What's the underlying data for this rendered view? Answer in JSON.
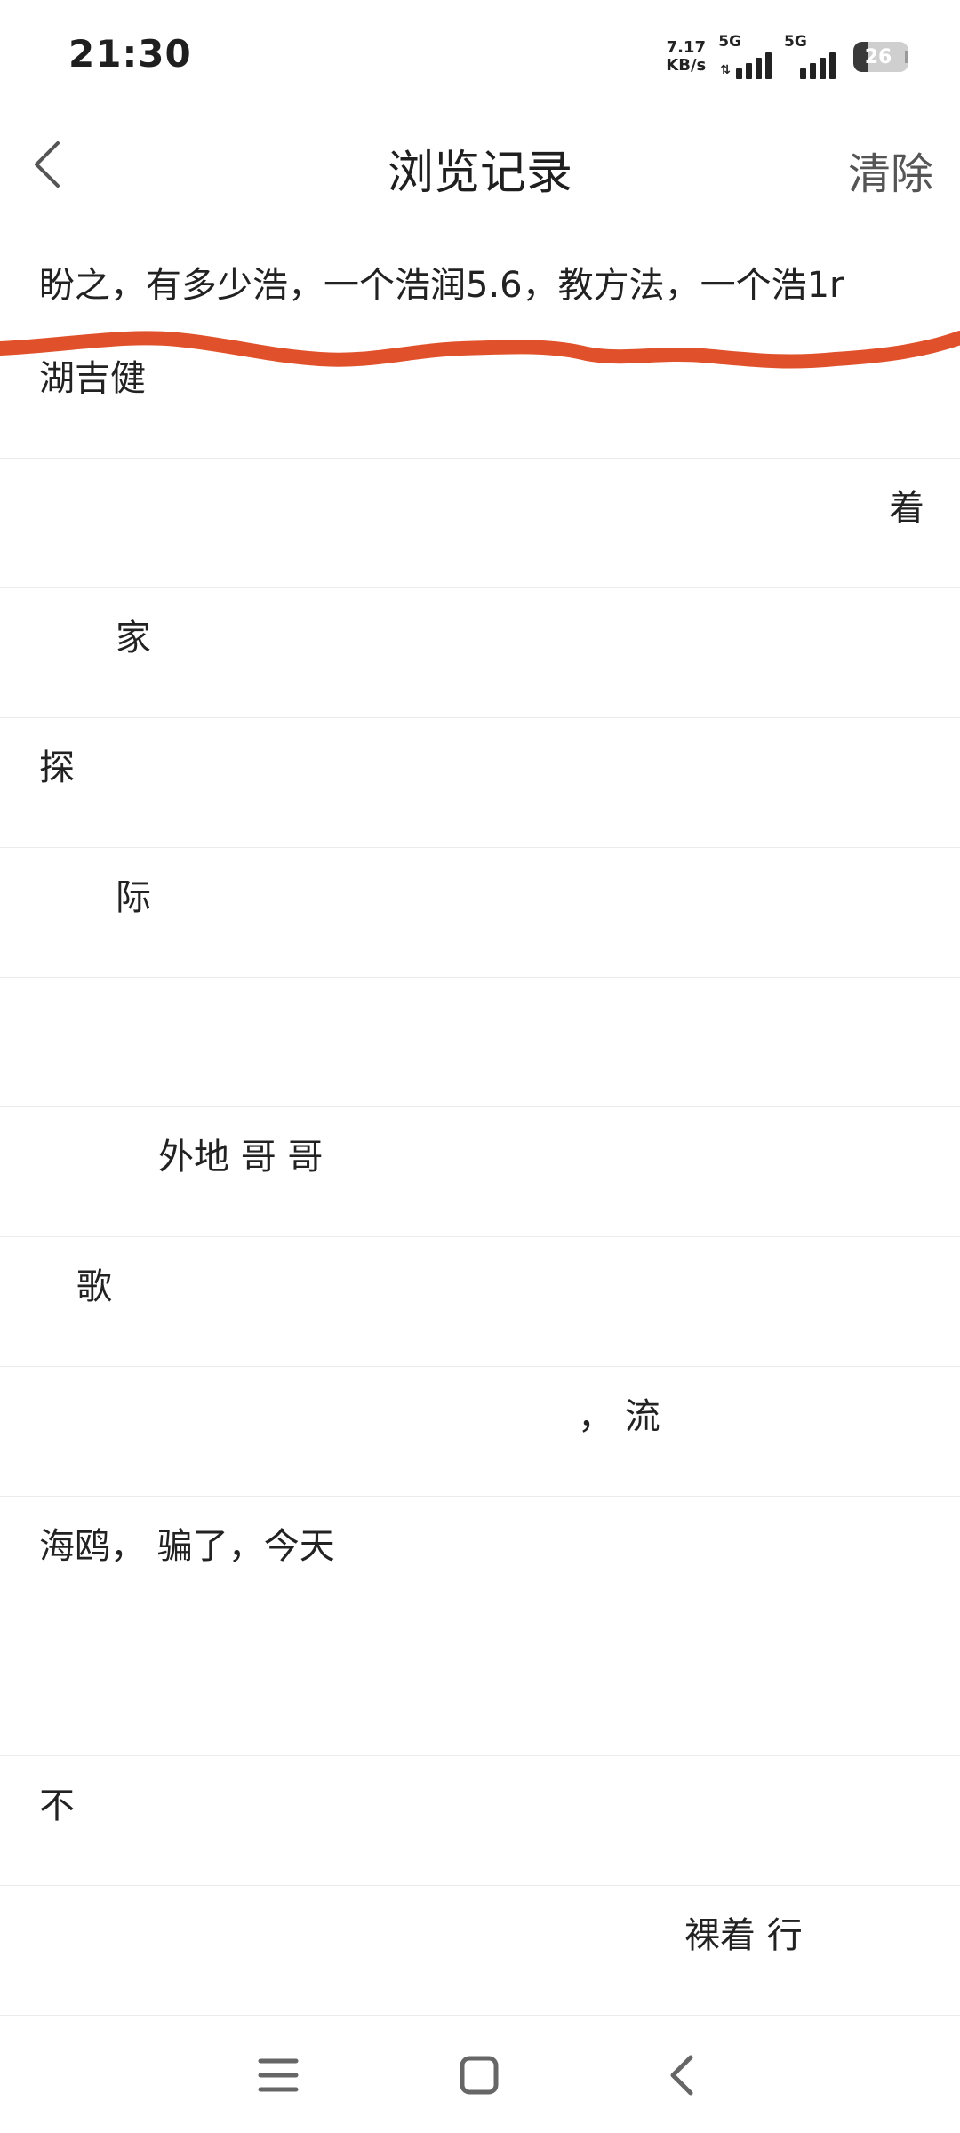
{
  "status_bar": {
    "time": "21:30",
    "net_speed_value": "7.17",
    "net_speed_unit": "KB/s",
    "sim1_label": "5G",
    "sim2_label": "5G",
    "battery_level": "26",
    "battery_fraction": 0.26
  },
  "header": {
    "title": "浏览记录",
    "clear_label": "清除",
    "back_icon": "chevron-left-icon"
  },
  "history": {
    "items": [
      {
        "text": "盼之，有多少浩，一个浩润5.6，教方法，一个浩1r"
      },
      {
        "text": "湖吉健"
      },
      {
        "text": "着"
      },
      {
        "text": "家"
      },
      {
        "text": "探"
      },
      {
        "text": "际"
      },
      {
        "text": ""
      },
      {
        "text": "外地 哥         哥"
      },
      {
        "text": "歌"
      },
      {
        "text": "，          流"
      },
      {
        "text": "海鸥，      骗了，今天"
      },
      {
        "text": ""
      },
      {
        "text": "不"
      },
      {
        "text": "裸着       行"
      }
    ]
  },
  "nav_bar": {
    "menu_icon": "menu-icon",
    "home_icon": "home-square-icon",
    "back_icon": "back-chevron-icon"
  },
  "colors": {
    "annotation_stroke": "#e0512b",
    "background": "#ffffff",
    "text": "#222222",
    "divider": "#ececec"
  }
}
